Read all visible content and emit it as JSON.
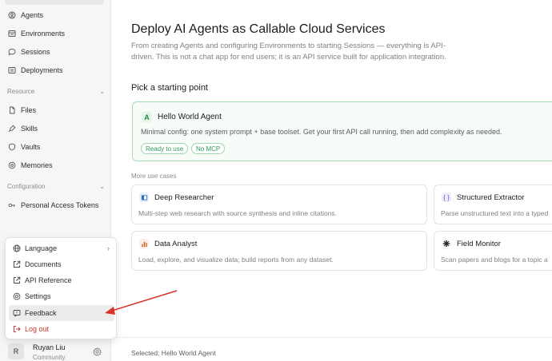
{
  "sidebar": {
    "nav": [
      {
        "label": "Agents",
        "icon": "agent-icon"
      },
      {
        "label": "Environments",
        "icon": "environment-icon"
      },
      {
        "label": "Sessions",
        "icon": "chat-bubble-icon"
      },
      {
        "label": "Deployments",
        "icon": "deploy-icon"
      }
    ],
    "resource_label": "Resource",
    "resource": [
      {
        "label": "Files",
        "icon": "file-icon"
      },
      {
        "label": "Skills",
        "icon": "skill-icon"
      },
      {
        "label": "Vaults",
        "icon": "shield-icon"
      },
      {
        "label": "Memories",
        "icon": "memory-icon"
      }
    ],
    "configuration_label": "Configuration",
    "configuration": [
      {
        "label": "Personal Access Tokens",
        "icon": "key-icon"
      }
    ]
  },
  "menu": {
    "items": [
      {
        "label": "Language",
        "icon": "globe-icon"
      },
      {
        "label": "Documents",
        "icon": "external-link-icon"
      },
      {
        "label": "API Reference",
        "icon": "external-link-icon"
      },
      {
        "label": "Settings",
        "icon": "gear-icon"
      },
      {
        "label": "Feedback",
        "icon": "feedback-icon"
      },
      {
        "label": "Log out",
        "icon": "logout-icon"
      }
    ]
  },
  "user": {
    "initial": "R",
    "name": "Ruyan Liu",
    "org": "Community"
  },
  "main": {
    "title": "Deploy AI Agents as Callable Cloud Services",
    "description": "From creating Agents and configuring Environments to starting Sessions — everything is API-driven. This is not a chat app for end users; it is an API service built for application integration.",
    "pick_label": "Pick a starting point",
    "hero": {
      "icon_letter": "A",
      "name": "Hello World Agent",
      "description": "Minimal config: one system prompt + base toolset. Get your first API call running, then add complexity as needed.",
      "tags": [
        "Ready to use",
        "No MCP"
      ]
    },
    "more_label": "More use cases",
    "use_cases": [
      {
        "name": "Deep Researcher",
        "description": "Multi-step web research with source synthesis and inline citations.",
        "icon": "book-icon"
      },
      {
        "name": "Structured Extractor",
        "description": "Parse unstructured text into a typed",
        "icon": "braces-icon",
        "glyph": "{ }"
      },
      {
        "name": "Data Analyst",
        "description": "Load, explore, and visualize data; build reports from any dataset.",
        "icon": "bar-chart-icon"
      },
      {
        "name": "Field Monitor",
        "description": "Scan papers and blogs for a topic a",
        "icon": "radar-icon"
      }
    ],
    "selected": "Selected: Hello World Agent"
  },
  "colors": {
    "accent_green": "#2f9a55",
    "danger": "#d0342c",
    "annotation_arrow": "#d9302a"
  }
}
